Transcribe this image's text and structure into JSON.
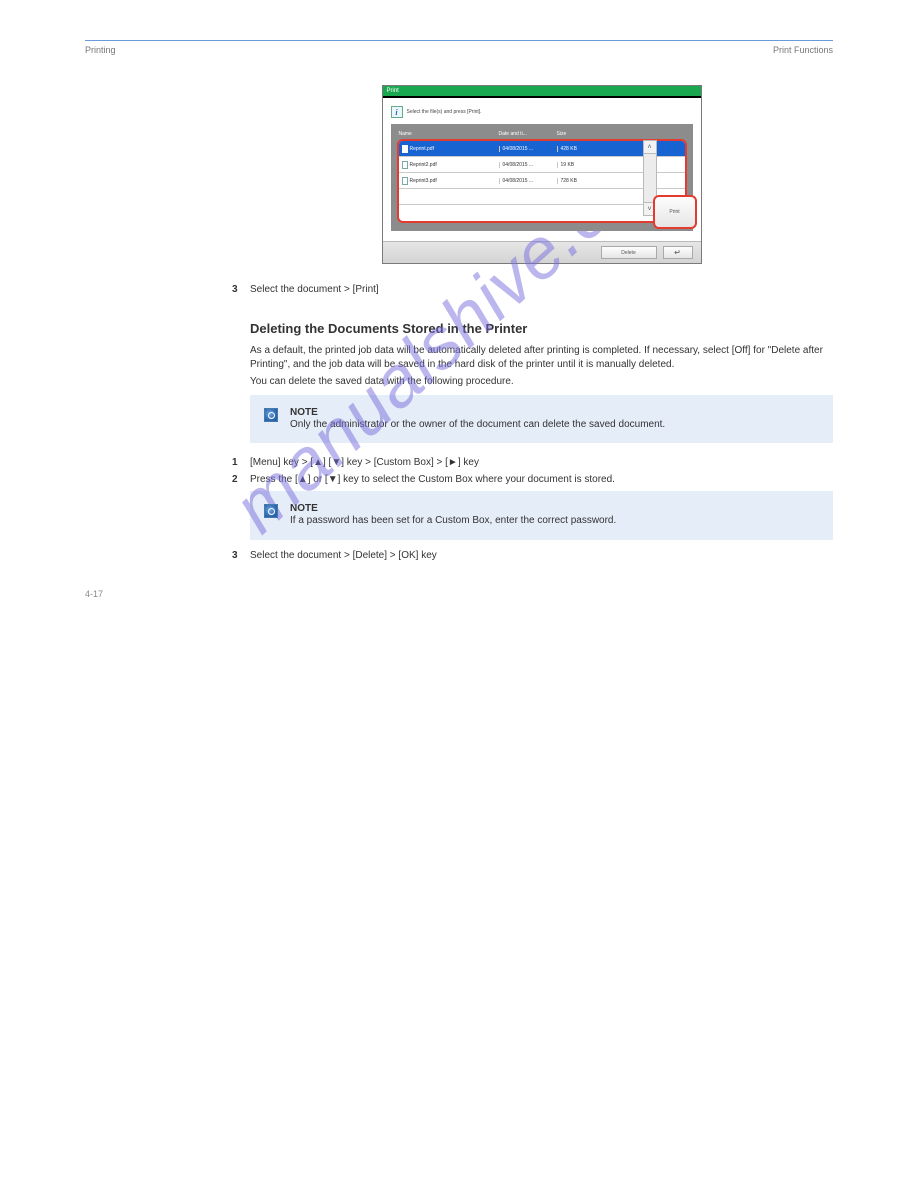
{
  "header": {
    "left": "Printing",
    "right": "Print Functions"
  },
  "watermark": "manualshive.com",
  "screenshot": {
    "title": "Print",
    "info_text": "Select the file(s) and press [Print].",
    "columns": {
      "name": "Name",
      "date": "Date and ti...",
      "size": "Size"
    },
    "rows": [
      {
        "name": "Reprint.pdf",
        "date": "04/08/2015 ...",
        "size": "428 KB",
        "selected": true
      },
      {
        "name": "Reprint2.pdf",
        "date": "04/08/2015 ...",
        "size": "19 KB",
        "selected": false
      },
      {
        "name": "Reprint3.pdf",
        "date": "04/08/2015 ...",
        "size": "728 KB",
        "selected": false
      },
      {
        "name": "",
        "date": "",
        "size": "",
        "selected": false
      },
      {
        "name": "",
        "date": "",
        "size": "",
        "selected": false
      }
    ],
    "print_btn": "Print",
    "footer_btn": "Delete",
    "footer_close": "↵"
  },
  "steps": {
    "s3": {
      "num": "3",
      "text": "Select the document > [Print]"
    }
  },
  "sec1": {
    "title": "Deleting the Documents Stored in the Printer",
    "intro": "As a default, the printed job data will be automatically deleted after printing is completed. If necessary, select [Off] for \"Delete after Printing\", and the job data will be saved in the hard disk of the printer until it is manually deleted.",
    "para2": "You can delete the saved data with the following procedure.",
    "note": {
      "label": "NOTE",
      "text": "Only the administrator or the owner of the document can delete the saved document."
    }
  },
  "block_steps": [
    {
      "num": "1",
      "text": "[Menu] key > [▲] [▼] key > [Custom Box] > [►] key"
    },
    {
      "num": "2",
      "text": "Press the [▲] or [▼] key to select the Custom Box where your document is stored."
    }
  ],
  "note2": {
    "label": "NOTE",
    "text": "If a password has been set for a Custom Box, enter the correct password."
  },
  "block_steps2": [
    {
      "num": "3",
      "text": "Select the document > [Delete] > [OK] key"
    }
  ],
  "footer": {
    "left": "4-17",
    "right": ""
  }
}
